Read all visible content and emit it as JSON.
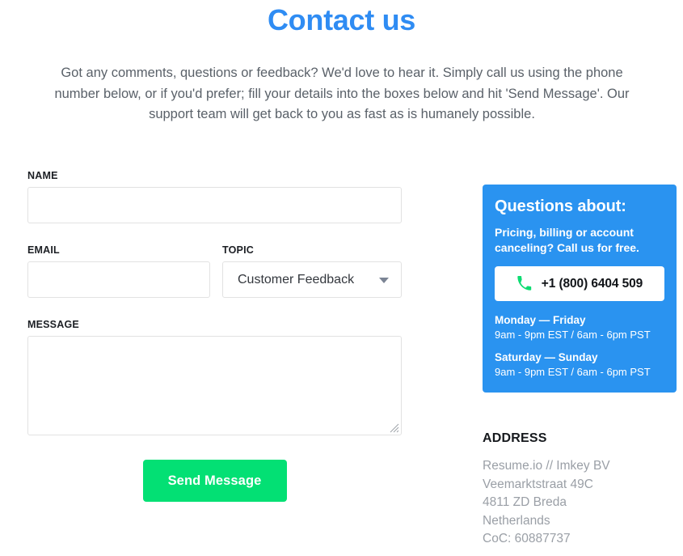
{
  "header": {
    "title": "Contact us",
    "intro": "Got any comments, questions or feedback? We'd love to hear it. Simply call us using the phone number below, or if you'd prefer; fill your details into the boxes below and hit 'Send Message'. Our support team will get back to you as fast as is humanely possible."
  },
  "form": {
    "name_label": "NAME",
    "name_value": "",
    "name_placeholder": "",
    "email_label": "EMAIL",
    "email_value": "",
    "email_placeholder": "",
    "topic_label": "TOPIC",
    "topic_selected": "Customer Feedback",
    "topic_options": [
      "Customer Feedback"
    ],
    "message_label": "MESSAGE",
    "message_value": "",
    "message_placeholder": "",
    "submit_label": "Send Message"
  },
  "info_card": {
    "title": "Questions about:",
    "subtitle": "Pricing, billing or account canceling? Call us for free.",
    "phone_icon": "phone-icon",
    "phone_number": "+1 (800) 6404 509",
    "hours": [
      {
        "days": "Monday — Friday",
        "time": "9am - 9pm EST / 6am - 6pm PST"
      },
      {
        "days": "Saturday — Sunday",
        "time": "9am - 9pm EST / 6am - 6pm PST"
      }
    ]
  },
  "address": {
    "title": "ADDRESS",
    "lines": [
      "Resume.io // Imkey BV",
      "Veemarktstraat 49C",
      "4811 ZD Breda",
      "Netherlands",
      "CoC: 60887737"
    ]
  },
  "colors": {
    "heading_blue": "#2f8cf3",
    "card_blue": "#2a93f0",
    "button_green": "#03e074",
    "body_text": "#5a6169",
    "muted_text": "#9a9fa6",
    "border": "#e2e2e2"
  }
}
